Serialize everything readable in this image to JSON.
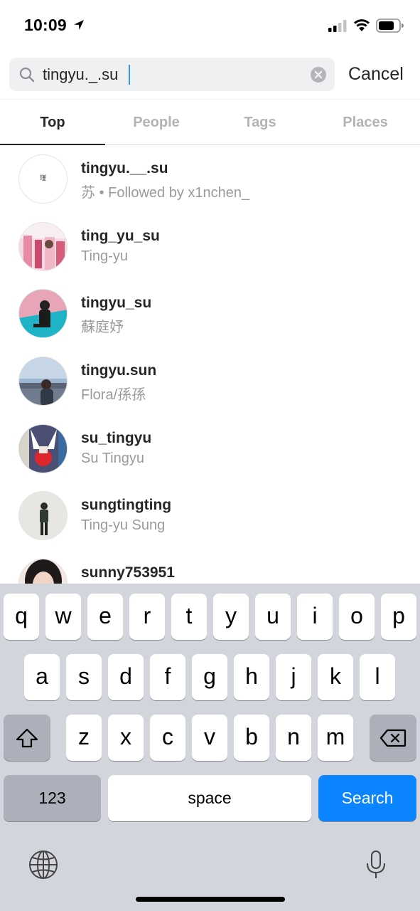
{
  "status_bar": {
    "time": "10:09",
    "icons": [
      "location-arrow-icon",
      "cellular-signal-icon",
      "wifi-icon",
      "battery-icon"
    ]
  },
  "search": {
    "query": "tingyu._.su",
    "icon": "magnifier-icon",
    "clear_icon": "clear-x-icon",
    "cancel_label": "Cancel"
  },
  "tabs": [
    {
      "label": "Top",
      "active": true
    },
    {
      "label": "People",
      "active": false
    },
    {
      "label": "Tags",
      "active": false
    },
    {
      "label": "Places",
      "active": false
    }
  ],
  "results": [
    {
      "username": "tingyu.__.su",
      "subtitle": "苏 • Followed by x1nchen_",
      "avatar_glyph": "瑾"
    },
    {
      "username": "ting_yu_su",
      "subtitle": "Ting-yu"
    },
    {
      "username": "tingyu_su",
      "subtitle": "蘇庭妤"
    },
    {
      "username": "tingyu.sun",
      "subtitle": "Flora/孫孫"
    },
    {
      "username": "su_tingyu",
      "subtitle": "Su Tingyu"
    },
    {
      "username": "sungtingting",
      "subtitle": "Ting-yu Sung"
    },
    {
      "username": "sunny753951",
      "subtitle": ""
    }
  ],
  "keyboard": {
    "row1": [
      "q",
      "w",
      "e",
      "r",
      "t",
      "y",
      "u",
      "i",
      "o",
      "p"
    ],
    "row2": [
      "a",
      "s",
      "d",
      "f",
      "g",
      "h",
      "j",
      "k",
      "l"
    ],
    "row3": [
      "z",
      "x",
      "c",
      "v",
      "b",
      "n",
      "m"
    ],
    "numbers_label": "123",
    "space_label": "space",
    "search_label": "Search",
    "icons": [
      "shift-icon",
      "backspace-icon",
      "globe-icon",
      "microphone-icon"
    ],
    "accent_color": "#0a84ff"
  }
}
